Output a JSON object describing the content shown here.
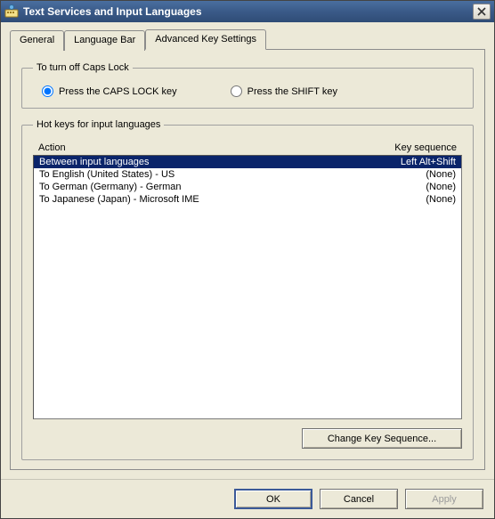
{
  "window": {
    "title": "Text Services and Input Languages"
  },
  "tabs": {
    "general": "General",
    "language_bar": "Language Bar",
    "advanced": "Advanced Key Settings"
  },
  "capslock": {
    "legend": "To turn off Caps Lock",
    "opt_caps": "Press the CAPS LOCK key",
    "opt_shift": "Press the SHIFT key"
  },
  "hotkeys": {
    "legend": "Hot keys for input languages",
    "col_action": "Action",
    "col_key": "Key sequence",
    "rows": [
      {
        "action": "Between input languages",
        "key": "Left Alt+Shift",
        "selected": true
      },
      {
        "action": "To English (United States) - US",
        "key": "(None)",
        "selected": false
      },
      {
        "action": "To German (Germany) - German",
        "key": "(None)",
        "selected": false
      },
      {
        "action": "To Japanese (Japan) - Microsoft IME",
        "key": "(None)",
        "selected": false
      }
    ],
    "change_button": "Change Key Sequence..."
  },
  "buttons": {
    "ok": "OK",
    "cancel": "Cancel",
    "apply": "Apply"
  }
}
